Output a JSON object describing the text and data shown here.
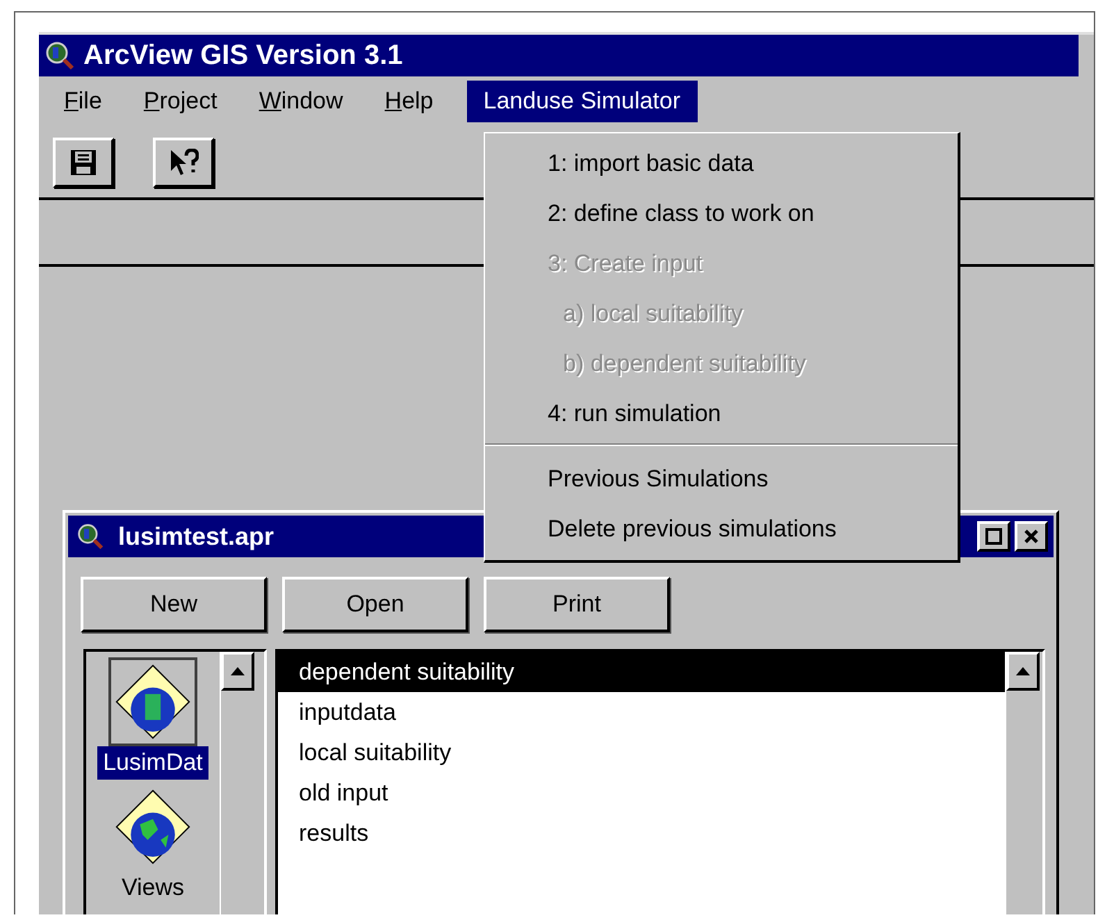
{
  "window": {
    "title": "ArcView GIS Version 3.1"
  },
  "menu_bar": [
    {
      "label": "File",
      "mnemonic_underlined": true,
      "selected": false
    },
    {
      "label": "Project",
      "mnemonic_underlined": true,
      "selected": false
    },
    {
      "label": "Window",
      "mnemonic_underlined": true,
      "selected": false
    },
    {
      "label": "Help",
      "mnemonic_underlined": true,
      "selected": false
    },
    {
      "label": "Landuse Simulator",
      "mnemonic_underlined": false,
      "selected": true
    }
  ],
  "dropdown_menu": {
    "groups": [
      [
        {
          "label": "1: import basic data",
          "disabled": false
        },
        {
          "label": "2: define class to work on",
          "disabled": false
        },
        {
          "label": "3: Create input",
          "disabled": true,
          "children": [
            {
              "label": "a) local suitability",
              "disabled": true
            },
            {
              "label": "b) dependent suitability",
              "disabled": true
            }
          ]
        },
        {
          "label": "4: run simulation",
          "disabled": false
        }
      ],
      [
        {
          "label": "Previous Simulations",
          "disabled": false
        },
        {
          "label": "Delete previous simulations",
          "disabled": false
        }
      ]
    ]
  },
  "project_window": {
    "title": "lusimtest.apr",
    "buttons": [
      "New",
      "Open",
      "Print"
    ],
    "doc_types": [
      {
        "label": "LusimDat",
        "selected": true
      },
      {
        "label": "Views",
        "selected": false
      }
    ],
    "documents": [
      {
        "label": "dependent suitability",
        "selected": true
      },
      {
        "label": "inputdata",
        "selected": false
      },
      {
        "label": "local suitability",
        "selected": false
      },
      {
        "label": "old input",
        "selected": false
      },
      {
        "label": "results",
        "selected": false
      }
    ]
  }
}
